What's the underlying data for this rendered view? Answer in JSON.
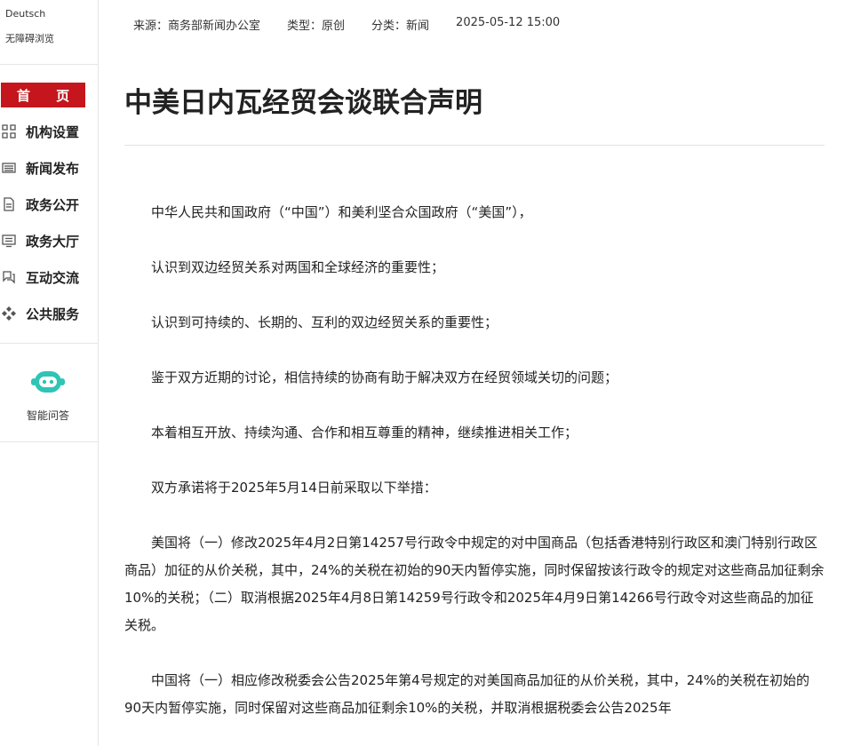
{
  "sidebar": {
    "lang_link": "Deutsch",
    "accessibility_link": "无障碍浏览",
    "home_label": "首 页",
    "items": [
      {
        "label": "机构设置",
        "icon": "grid-icon"
      },
      {
        "label": "新闻发布",
        "icon": "newspaper-icon"
      },
      {
        "label": "政务公开",
        "icon": "document-icon"
      },
      {
        "label": "政务大厅",
        "icon": "monitor-icon"
      },
      {
        "label": "互动交流",
        "icon": "chat-icon"
      },
      {
        "label": "公共服务",
        "icon": "diamond-icon"
      }
    ],
    "ai_label": "智能问答"
  },
  "meta": {
    "source": "来源：商务部新闻办公室",
    "type": "类型：原创",
    "category": "分类：新闻",
    "datetime": "2025-05-12 15:00"
  },
  "article": {
    "title": "中美日内瓦经贸会谈联合声明",
    "paragraphs": [
      "中华人民共和国政府（“中国”）和美利坚合众国政府（“美国”），",
      "认识到双边经贸关系对两国和全球经济的重要性；",
      "认识到可持续的、长期的、互利的双边经贸关系的重要性；",
      "鉴于双方近期的讨论，相信持续的协商有助于解决双方在经贸领域关切的问题；",
      "本着相互开放、持续沟通、合作和相互尊重的精神，继续推进相关工作；",
      "双方承诺将于2025年5月14日前采取以下举措：",
      "美国将（一）修改2025年4月2日第14257号行政令中规定的对中国商品（包括香港特别行政区和澳门特别行政区商品）加征的从价关税，其中，24%的关税在初始的90天内暂停实施，同时保留按该行政令的规定对这些商品加征剩余10%的关税；（二）取消根据2025年4月8日第14259号行政令和2025年4月9日第14266号行政令对这些商品的加征关税。",
      "中国将（一）相应修改税委会公告2025年第4号规定的对美国商品加征的从价关税，其中，24%的关税在初始的90天内暂停实施，同时保留对这些商品加征剩余10%的关税，并取消根据税委会公告2025年"
    ]
  },
  "colors": {
    "accent": "#c4161c",
    "ai_icon": "#2ec4b6"
  }
}
